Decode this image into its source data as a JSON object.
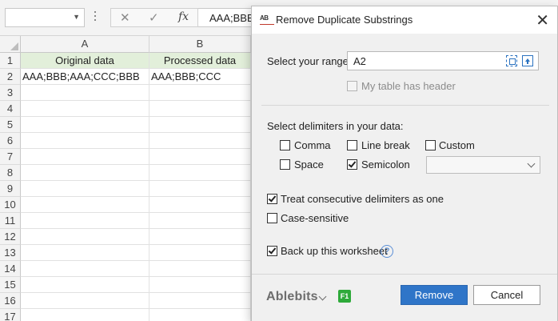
{
  "excel": {
    "name_box": "",
    "formula_value": "AAA;BBB;AAA;CCC;BBB",
    "columns": [
      "A",
      "B"
    ],
    "rows": [
      "1",
      "2",
      "3",
      "4",
      "5",
      "6",
      "7",
      "8",
      "9",
      "10",
      "11",
      "12",
      "13",
      "14",
      "15",
      "16",
      "17"
    ],
    "cells": {
      "A1": "Original data",
      "B1": "Processed data",
      "A2": "AAA;BBB;AAA;CCC;BBB",
      "B2": "AAA;BBB;CCC"
    },
    "header_fill": "#e2efda"
  },
  "dialog": {
    "title": "Remove Duplicate Substrings",
    "icon_label": "AB",
    "range_label": "Select your range:",
    "range_value": "A2",
    "header_checkbox": {
      "label": "My table has header",
      "checked": false,
      "enabled": false
    },
    "delimiters_label": "Select delimiters in your data:",
    "delimiters": [
      {
        "label": "Comma",
        "checked": false
      },
      {
        "label": "Line break",
        "checked": false
      },
      {
        "label": "Custom",
        "checked": false
      },
      {
        "label": "Space",
        "checked": false
      },
      {
        "label": "Semicolon",
        "checked": true
      }
    ],
    "custom_value": "",
    "options": [
      {
        "label": "Treat consecutive delimiters as one",
        "checked": true
      },
      {
        "label": "Case-sensitive",
        "checked": false
      },
      {
        "label": "Back up this worksheet",
        "checked": true
      }
    ],
    "help_glyph": "?",
    "brand": "Ablebits",
    "f1": "F1",
    "remove_label": "Remove",
    "cancel_label": "Cancel",
    "accent_color": "#2f75c8"
  }
}
